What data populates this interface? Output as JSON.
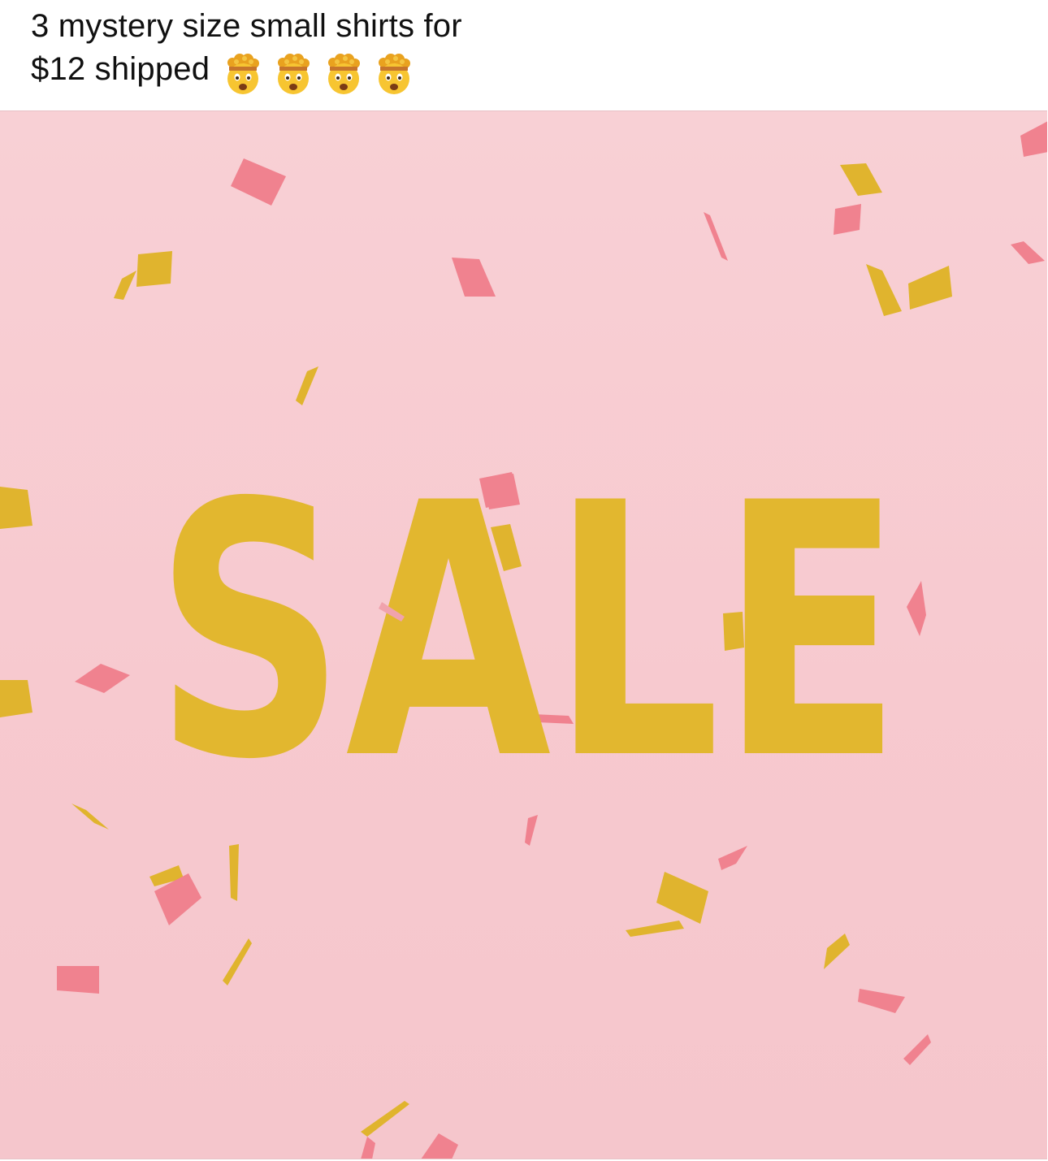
{
  "post": {
    "caption_line1": "3 mystery size small shirts for",
    "caption_line2": "$12 shipped",
    "emoji_icons": [
      "exploding-head-icon",
      "exploding-head-icon",
      "exploding-head-icon",
      "exploding-head-icon"
    ]
  },
  "media": {
    "headline": "SALE",
    "colors": {
      "background": "#f7cbd1",
      "headline": "#e2b72f",
      "confetti_gold": "#e0b42e",
      "confetti_pink": "#f0828f"
    },
    "confetti_colors": [
      "gold",
      "pink"
    ]
  }
}
